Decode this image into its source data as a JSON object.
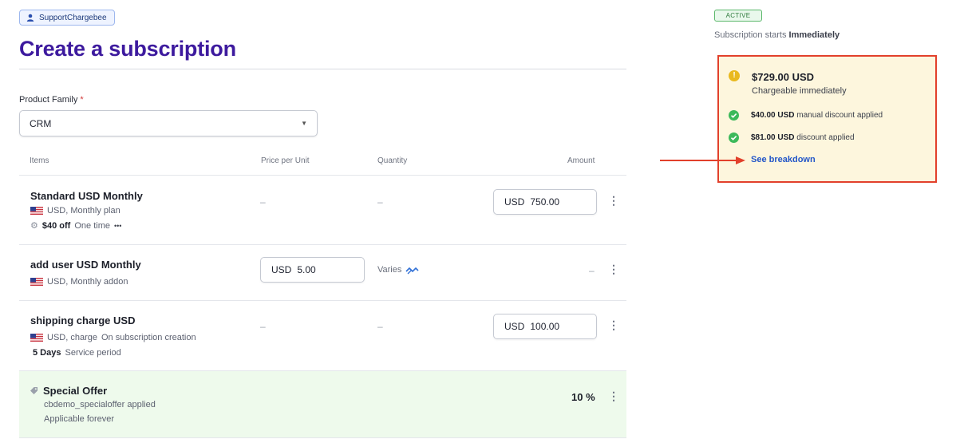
{
  "header": {
    "user_chip": "SupportChargebee",
    "page_title": "Create a subscription"
  },
  "form": {
    "product_family_label": "Product Family",
    "required_mark": "*",
    "product_family_value": "CRM"
  },
  "table": {
    "headers": [
      "Items",
      "Price per Unit",
      "Quantity",
      "Amount"
    ],
    "dash": "–",
    "rows": [
      {
        "name": "Standard USD Monthly",
        "sub": "USD, Monthly plan",
        "discount_amount": "$40 off",
        "discount_type": "One time",
        "more": "•••",
        "amount_currency": "USD",
        "amount_value": "750.00"
      },
      {
        "name": "add user USD Monthly",
        "sub": "USD, Monthly addon",
        "price_currency": "USD",
        "price_value": "5.00",
        "quantity": "Varies"
      },
      {
        "name": "shipping charge USD",
        "sub": "USD, charge",
        "sub_extra": "On subscription creation",
        "service_days": "5 Days",
        "service_label": "Service period",
        "amount_currency": "USD",
        "amount_value": "100.00"
      }
    ],
    "offer": {
      "name": "Special Offer",
      "applied": "cbdemo_specialoffer applied",
      "duration": "Applicable forever",
      "value": "10 %"
    }
  },
  "summary": {
    "status_badge": "ACTIVE",
    "starts_prefix": "Subscription starts",
    "starts_value": "Immediately",
    "total": "$729.00 USD",
    "chargeable": "Chargeable immediately",
    "discounts": [
      {
        "amount": "$40.00 USD",
        "label": "manual discount applied"
      },
      {
        "amount": "$81.00 USD",
        "label": "discount applied"
      }
    ],
    "breakdown_link": "See breakdown"
  },
  "colors": {
    "title": "#3d1a9e",
    "highlight_border": "#e2402b",
    "summary_bg": "#fdf6dd",
    "offer_bg": "#eefaec",
    "link": "#2356c8"
  }
}
